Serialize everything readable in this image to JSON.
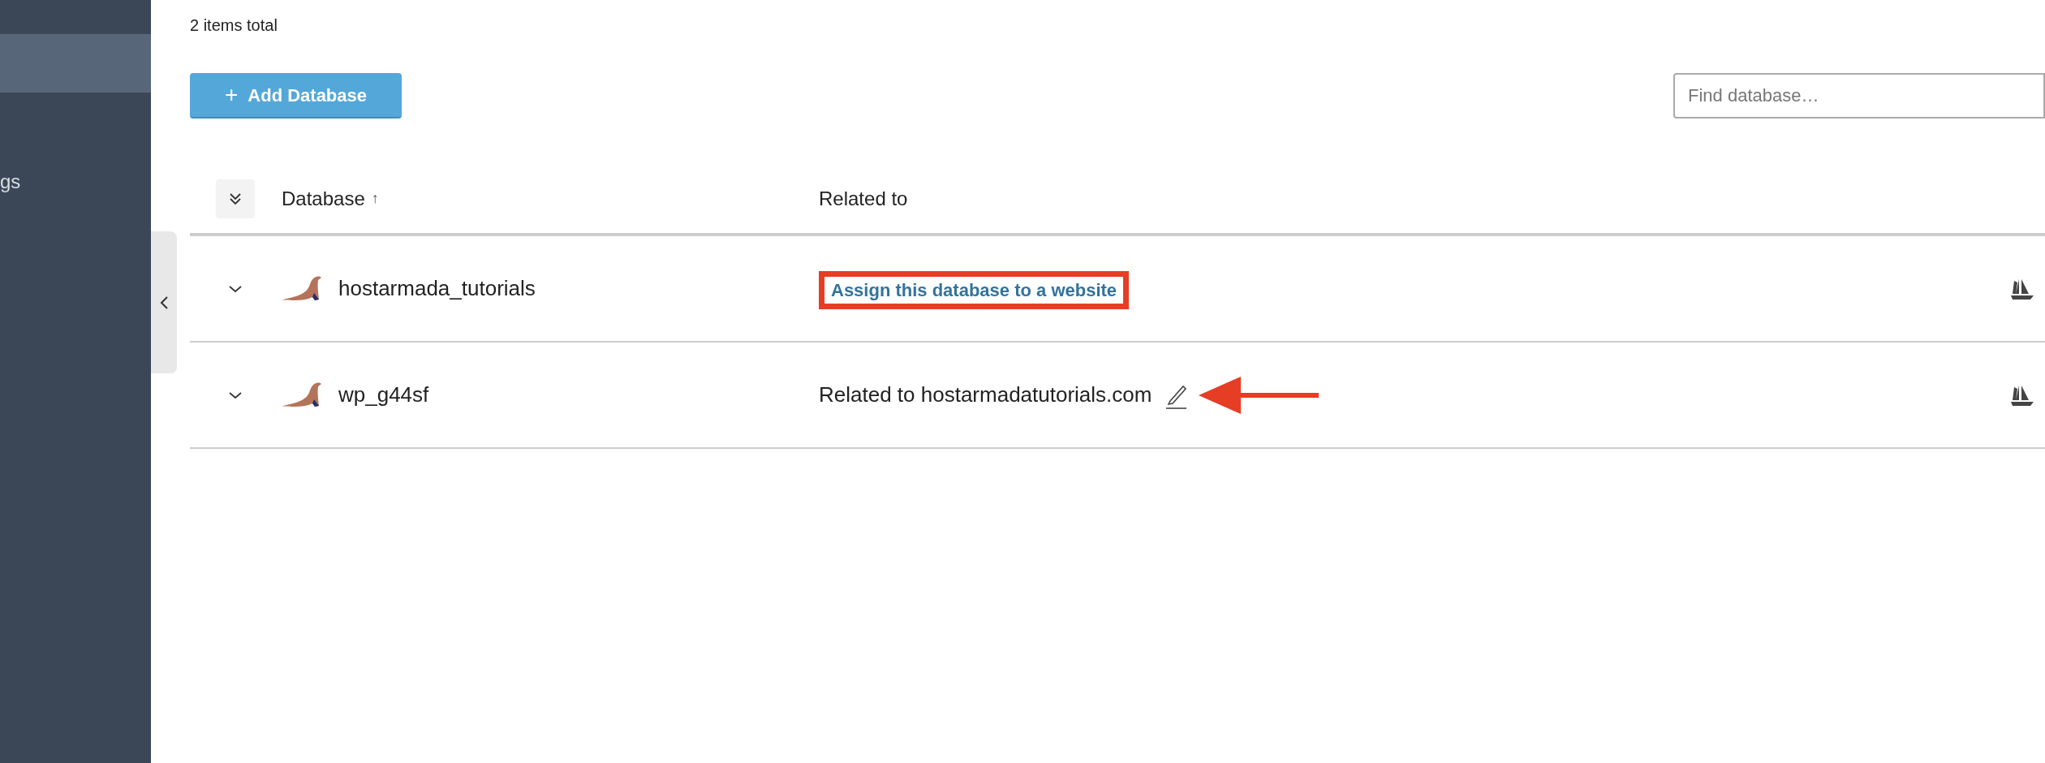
{
  "sidebar": {
    "items": [
      {
        "selected": true
      },
      {
        "label": "gs",
        "selected": false
      }
    ]
  },
  "summary": "2 items total",
  "toolbar": {
    "add_button": {
      "icon": "+",
      "label": "Add Database"
    },
    "search": {
      "placeholder": "Find database…"
    }
  },
  "table": {
    "columns": [
      {
        "label": "Database",
        "sort_mark": "↑"
      },
      {
        "label": "Related to"
      }
    ],
    "rows": [
      {
        "name": "hostarmada_tutorials",
        "related": {
          "kind": "link",
          "text": "Assign this database to a website",
          "editable": false
        },
        "highlighted": true,
        "pointed_at": false
      },
      {
        "name": "wp_g44sf",
        "related": {
          "kind": "text",
          "text": "Related to hostarmadatutorials.com",
          "editable": true
        },
        "highlighted": false,
        "pointed_at": true
      }
    ]
  }
}
